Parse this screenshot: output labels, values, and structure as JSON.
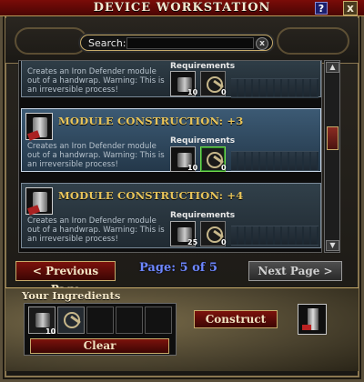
{
  "window": {
    "title": "DEVICE WORKSTATION",
    "help_label": "?",
    "close_label": "x"
  },
  "search": {
    "label": "Search:",
    "value": "",
    "placeholder": "",
    "clear_label": "x"
  },
  "recipes": [
    {
      "name": "",
      "description": "Creates an Iron Defender module out of a handwrap. Warning: This is an irreversible process!",
      "requirements_label": "Requirements",
      "requirements": [
        {
          "icon": "device-icon",
          "qty": "10"
        },
        {
          "icon": "key-icon",
          "qty": "0"
        }
      ],
      "selected": false
    },
    {
      "name": "MODULE CONSTRUCTION: +3",
      "description": "Creates an Iron Defender module out of a handwrap. Warning: This is an irreversible process!",
      "requirements_label": "Requirements",
      "requirements": [
        {
          "icon": "device-icon",
          "qty": "10"
        },
        {
          "icon": "key-icon",
          "qty": "0"
        }
      ],
      "selected": true
    },
    {
      "name": "MODULE CONSTRUCTION: +4",
      "description": "Creates an Iron Defender module out of a handwrap. Warning: This is an irreversible process!",
      "requirements_label": "Requirements",
      "requirements": [
        {
          "icon": "device-icon",
          "qty": "25"
        },
        {
          "icon": "key-icon",
          "qty": "0"
        }
      ],
      "selected": false
    }
  ],
  "paging": {
    "prev_label": "< Previous Page",
    "page_text": "Page: 5 of 5",
    "next_label": "Next Page  >"
  },
  "ingredients": {
    "title": "Your Ingredients",
    "items": [
      {
        "icon": "device-icon",
        "qty": "10"
      },
      {
        "icon": "key-icon",
        "qty": ""
      }
    ],
    "clear_label": "Clear"
  },
  "construct_label": "Construct",
  "colors": {
    "title_bar": "#7a0c08",
    "recipe_name": "#e9c55a",
    "page_text": "#6d87ff"
  }
}
